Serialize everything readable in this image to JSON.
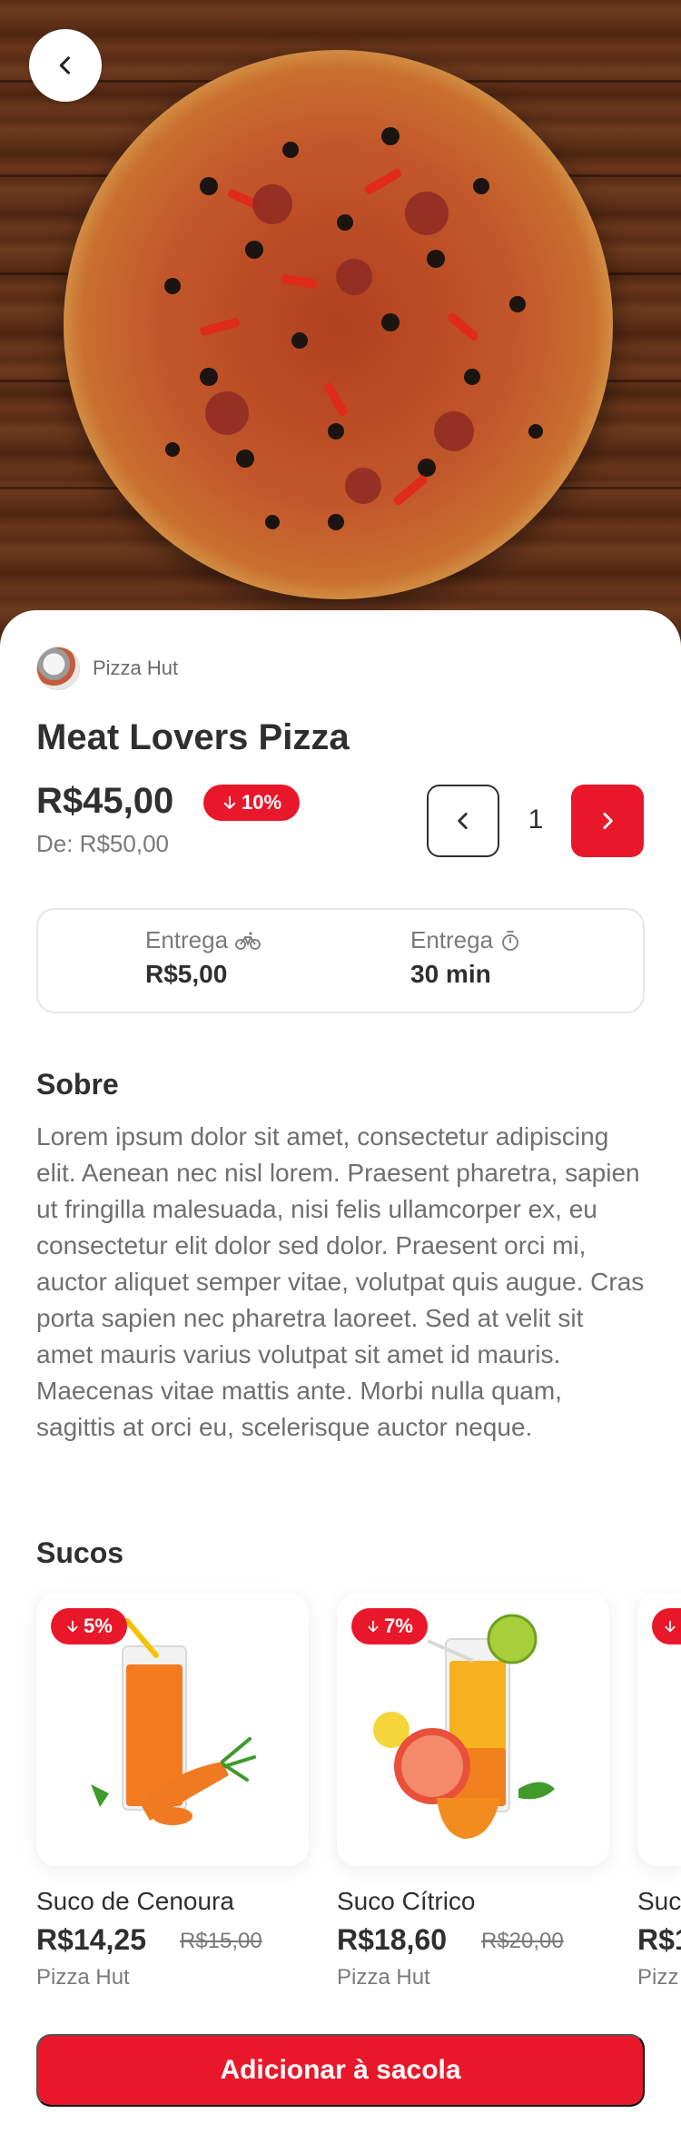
{
  "colors": {
    "accent": "#e8182a",
    "text": "#2f2f2f",
    "muted": "#7a7a7a"
  },
  "header": {
    "back_icon": "chevron-left-icon"
  },
  "store": {
    "name": "Pizza Hut"
  },
  "product": {
    "title": "Meat Lovers Pizza",
    "price": "R$45,00",
    "discount": "10%",
    "old_price": "De: R$50,00",
    "quantity": "1"
  },
  "delivery": {
    "fee_label": "Entrega",
    "fee_value": "R$5,00",
    "fee_icon": "bike-icon",
    "time_label": "Entrega",
    "time_value": "30 min",
    "time_icon": "timer-icon"
  },
  "about": {
    "title": "Sobre",
    "text": "Lorem ipsum dolor sit amet, consectetur adipiscing elit. Aenean nec nisl lorem. Praesent pharetra, sapien ut fringilla malesuada, nisi felis ullamcorper ex, eu consectetur elit dolor sed dolor. Praesent orci mi, auctor aliquet semper vitae, volutpat quis augue. Cras porta sapien nec pharetra laoreet. Sed at velit sit amet mauris varius volutpat sit amet id mauris. Maecenas vitae mattis ante. Morbi nulla quam, sagittis at orci eu, scelerisque auctor neque."
  },
  "juices": {
    "title": "Sucos",
    "items": [
      {
        "name": "Suco de Cenoura",
        "price": "R$14,25",
        "old_price": "R$15,00",
        "discount": "5%",
        "store": "Pizza Hut"
      },
      {
        "name": "Suco Cítrico",
        "price": "R$18,60",
        "old_price": "R$20,00",
        "discount": "7%",
        "store": "Pizza Hut"
      },
      {
        "name": "Suc",
        "price": "R$1",
        "store": "Pizz"
      }
    ]
  },
  "cta": {
    "label": "Adicionar à sacola"
  }
}
